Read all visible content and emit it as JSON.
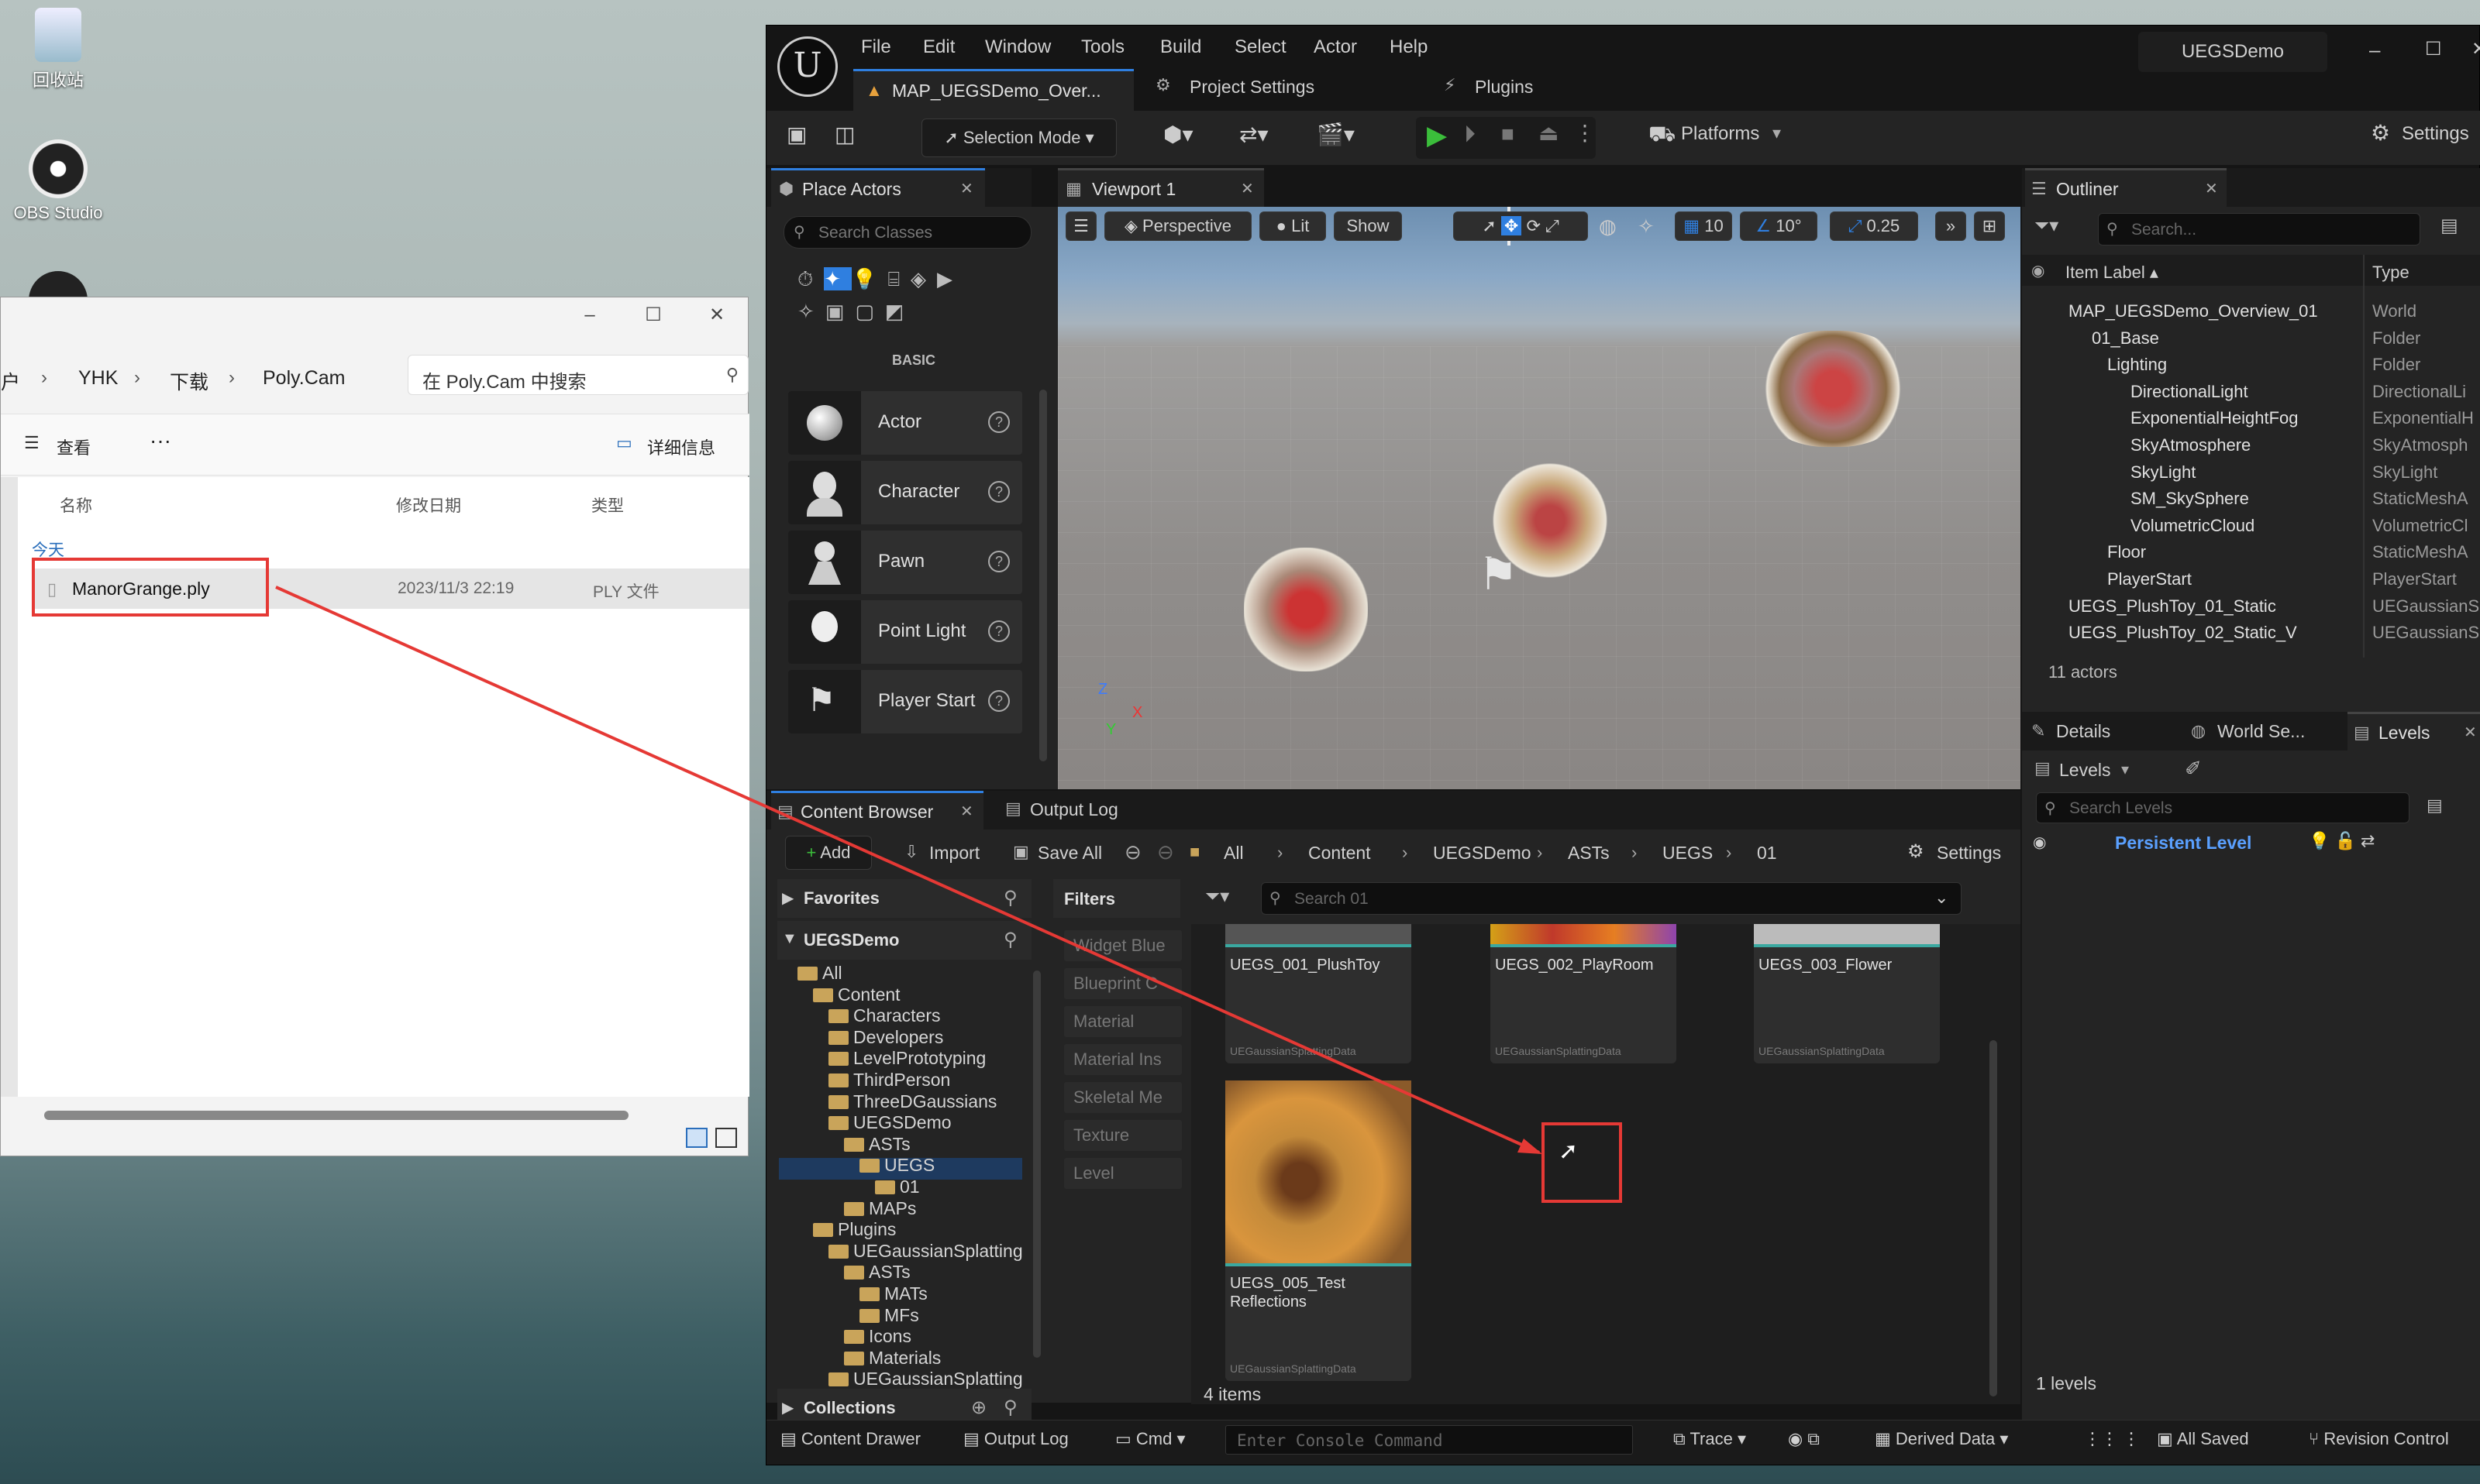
{
  "desktop": {
    "icons": [
      {
        "label": "回收站"
      },
      {
        "label": "OBS Studio"
      }
    ]
  },
  "explorer": {
    "breadcrumb": [
      "户",
      "YHK",
      "下载",
      "Poly.Cam"
    ],
    "search_placeholder": "在 Poly.Cam 中搜索",
    "toolbar": {
      "view_label": "查看",
      "more_label": "···",
      "details_label": "详细信息"
    },
    "columns": {
      "name": "名称",
      "modified": "修改日期",
      "type": "类型"
    },
    "group": "今天",
    "files": [
      {
        "name": "ManorGrange.ply",
        "modified": "2023/11/3 22:19",
        "type": "PLY 文件"
      }
    ]
  },
  "ue": {
    "project_name": "UEGSDemo",
    "menu": [
      "File",
      "Edit",
      "Window",
      "Tools",
      "Build",
      "Select",
      "Actor",
      "Help"
    ],
    "doc_tabs": {
      "map": "MAP_UEGSDemo_Over...",
      "project_settings": "Project Settings",
      "plugins": "Plugins"
    },
    "toolbar": {
      "selection_mode": "Selection Mode",
      "platforms": "Platforms",
      "settings": "Settings"
    },
    "place_actors": {
      "tab": "Place Actors",
      "search_placeholder": "Search Classes",
      "category": "BASIC",
      "items": [
        "Actor",
        "Character",
        "Pawn",
        "Point Light",
        "Player Start"
      ]
    },
    "viewport": {
      "tab": "Viewport 1",
      "perspective": "Perspective",
      "lit": "Lit",
      "show": "Show",
      "grid": "10",
      "angle": "10°",
      "scale": "0.25"
    },
    "content_browser": {
      "tab": "Content Browser",
      "output_tab": "Output Log",
      "add": "Add",
      "import": "Import",
      "save_all": "Save All",
      "path": [
        "All",
        "Content",
        "UEGSDemo",
        "ASTs",
        "UEGS",
        "01"
      ],
      "settings": "Settings",
      "favorites": "Favorites",
      "root": "UEGSDemo",
      "collections": "Collections",
      "filters_title": "Filters",
      "search_placeholder": "Search 01",
      "filters": [
        "Widget Blue",
        "Blueprint C",
        "Material",
        "Material Ins",
        "Skeletal Me",
        "Texture",
        "Level"
      ],
      "tree": [
        {
          "label": "All",
          "depth": 0
        },
        {
          "label": "Content",
          "depth": 1
        },
        {
          "label": "Characters",
          "depth": 2
        },
        {
          "label": "Developers",
          "depth": 2
        },
        {
          "label": "LevelPrototyping",
          "depth": 2
        },
        {
          "label": "ThirdPerson",
          "depth": 2
        },
        {
          "label": "ThreeDGaussians",
          "depth": 2
        },
        {
          "label": "UEGSDemo",
          "depth": 2
        },
        {
          "label": "ASTs",
          "depth": 3
        },
        {
          "label": "UEGS",
          "depth": 4
        },
        {
          "label": "01",
          "depth": 5
        },
        {
          "label": "MAPs",
          "depth": 3
        },
        {
          "label": "Plugins",
          "depth": 1
        },
        {
          "label": "UEGaussianSplatting",
          "depth": 2
        },
        {
          "label": "ASTs",
          "depth": 3
        },
        {
          "label": "MATs",
          "depth": 4
        },
        {
          "label": "MFs",
          "depth": 4
        },
        {
          "label": "Icons",
          "depth": 3
        },
        {
          "label": "Materials",
          "depth": 3
        },
        {
          "label": "UEGaussianSplatting",
          "depth": 2
        }
      ],
      "assets": [
        {
          "name": "UEGS_001_PlushToy",
          "type": "UEGaussianSplattingData"
        },
        {
          "name": "UEGS_002_PlayRoom",
          "type": "UEGaussianSplattingData"
        },
        {
          "name": "UEGS_003_Flower",
          "type": "UEGaussianSplattingData"
        },
        {
          "name": "UEGS_005_Test Reflections",
          "type": "UEGaussianSplattingData"
        }
      ],
      "item_count": "4 items"
    },
    "outliner": {
      "tab": "Outliner",
      "search_placeholder": "Search...",
      "col_label": "Item Label ▴",
      "col_type": "Type",
      "rows": [
        {
          "label": "MAP_UEGSDemo_Overview_01",
          "type": "World"
        },
        {
          "label": "01_Base",
          "type": "Folder"
        },
        {
          "label": "Lighting",
          "type": "Folder"
        },
        {
          "label": "DirectionalLight",
          "type": "DirectionalLi"
        },
        {
          "label": "ExponentialHeightFog",
          "type": "ExponentialH"
        },
        {
          "label": "SkyAtmosphere",
          "type": "SkyAtmosph"
        },
        {
          "label": "SkyLight",
          "type": "SkyLight"
        },
        {
          "label": "SM_SkySphere",
          "type": "StaticMeshA"
        },
        {
          "label": "VolumetricCloud",
          "type": "VolumetricCl"
        },
        {
          "label": "Floor",
          "type": "StaticMeshA"
        },
        {
          "label": "PlayerStart",
          "type": "PlayerStart"
        },
        {
          "label": "UEGS_PlushToy_01_Static",
          "type": "UEGaussianS"
        },
        {
          "label": "UEGS_PlushToy_02_Static_V",
          "type": "UEGaussianS"
        }
      ],
      "actor_count": "11 actors"
    },
    "levels_panel": {
      "details": "Details",
      "world": "World Se...",
      "levels": "Levels",
      "levels_btn": "Levels",
      "search_placeholder": "Search Levels",
      "persistent": "Persistent Level",
      "level_count": "1 levels"
    },
    "status": {
      "content_drawer": "Content Drawer",
      "output_log": "Output Log",
      "cmd": "Cmd",
      "console_placeholder": "Enter Console Command",
      "trace": "Trace",
      "derived_data": "Derived Data",
      "all_saved": "All Saved",
      "revision": "Revision Control"
    },
    "colors": {
      "accent": "#2f7fe0",
      "play": "#3bbd3b",
      "folder": "#c9a45a",
      "highlight": "#e53935"
    }
  }
}
